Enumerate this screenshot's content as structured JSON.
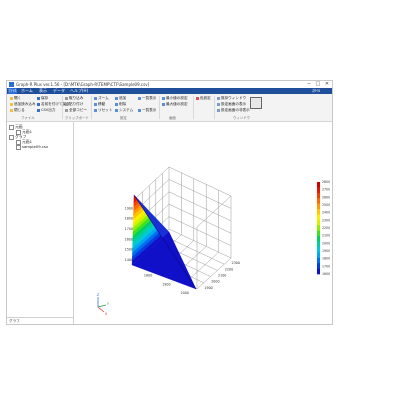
{
  "app": {
    "title": "Graph-R Plus ver.1.56 - [D:\\MTK\\Graph-R\\TEMP\\CTF\\Sample09.csv]",
    "minimize": "─",
    "maximize": "□",
    "close": "✕"
  },
  "menu": {
    "file": "ﾌｧｲﾙ",
    "home": "ホーム",
    "view": "表示",
    "data": "データ",
    "help": "ヘルプ(H)",
    "right_label": "ｽﾀｲﾙ"
  },
  "ribbon": {
    "col1": [
      "開く",
      "追加読み込み",
      "閉じる"
    ],
    "col2": [
      "保存",
      "名前を付けて保存",
      "CSV出力"
    ],
    "col3": [
      "取り込み",
      "貼り付け",
      "全部コピー"
    ],
    "col4": [
      "ズーム",
      "移動",
      "リセット"
    ],
    "col5": [
      "追加",
      "削除",
      "システム"
    ],
    "col6": [
      "一覧表示",
      "一覧表示"
    ],
    "col7": [
      "最小値の設定",
      "最大値の設定"
    ],
    "col8": [
      "色設定"
    ],
    "col9": [
      "既存ウィンドウ",
      "設定画面の表示",
      "設定画面の非表示"
    ],
    "groups": [
      "ファイル",
      "クリップボード",
      "設定",
      "画面",
      "ウィンドウ"
    ]
  },
  "tree": {
    "items": [
      "元画",
      "元画1",
      "グラフ",
      "元画1",
      "sample09.csv"
    ]
  },
  "side_footer": "グラフ",
  "icons": [
    "app-icon",
    "folder-icon",
    "save-icon",
    "paste-icon",
    "zoom-icon",
    "window-icon",
    "tree-node-icon",
    "colorbar-icon",
    "axis-triad-icon"
  ],
  "colors": {
    "menubar": "#1f4e9b",
    "accent": "#2b6cd4"
  },
  "chart_data": {
    "type": "surface3d",
    "title": "",
    "xlabel": "",
    "ylabel": "",
    "zlabel": "",
    "z_ticks": [
      1500,
      1600,
      1700,
      1800,
      1900
    ],
    "x_ticks": [
      1800,
      1900,
      2000
    ],
    "y_ticks": [
      1900,
      2000,
      2100,
      2200,
      2300
    ],
    "surface_z_range": [
      1400,
      1900
    ],
    "colorbar": {
      "min": 1600,
      "max": 2800,
      "ticks": [
        2800,
        2700,
        2600,
        2500,
        2400,
        2300,
        2200,
        2100,
        2000,
        1900,
        1800,
        1700,
        1600
      ],
      "colors": [
        "#d40000",
        "#e01800",
        "#f04000",
        "#ff6a00",
        "#ff9a00",
        "#ffc600",
        "#ffee00",
        "#d8f000",
        "#8ef000",
        "#40e020",
        "#00d060",
        "#00d0a0",
        "#00c8d8",
        "#00a8f0",
        "#0070f0",
        "#0040e0",
        "#1010c8"
      ]
    },
    "grid": true,
    "axis_triad": [
      "X",
      "Y",
      "Z"
    ]
  }
}
